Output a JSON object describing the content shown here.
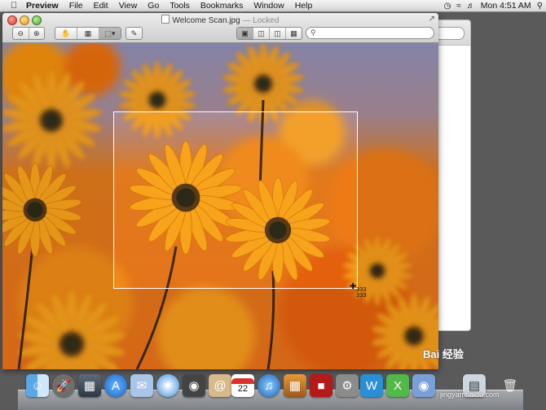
{
  "menubar": {
    "apple": "",
    "app_name": "Preview",
    "items": [
      "File",
      "Edit",
      "View",
      "Go",
      "Tools",
      "Bookmarks",
      "Window",
      "Help"
    ],
    "clock": "Mon 4:51 AM"
  },
  "window": {
    "title": "Welcome Scan.jpg",
    "locked_suffix": "— Locked"
  },
  "selection": {
    "size_readout_w": "333",
    "size_readout_h": "333"
  },
  "watermark": {
    "logo_text": "Bai 经验",
    "site": "jingyan.baidu.com"
  },
  "dock": {
    "calendar_day": "22"
  },
  "colors": {
    "accent_orange": "#f08a12",
    "sky": "#8f8fb8"
  }
}
